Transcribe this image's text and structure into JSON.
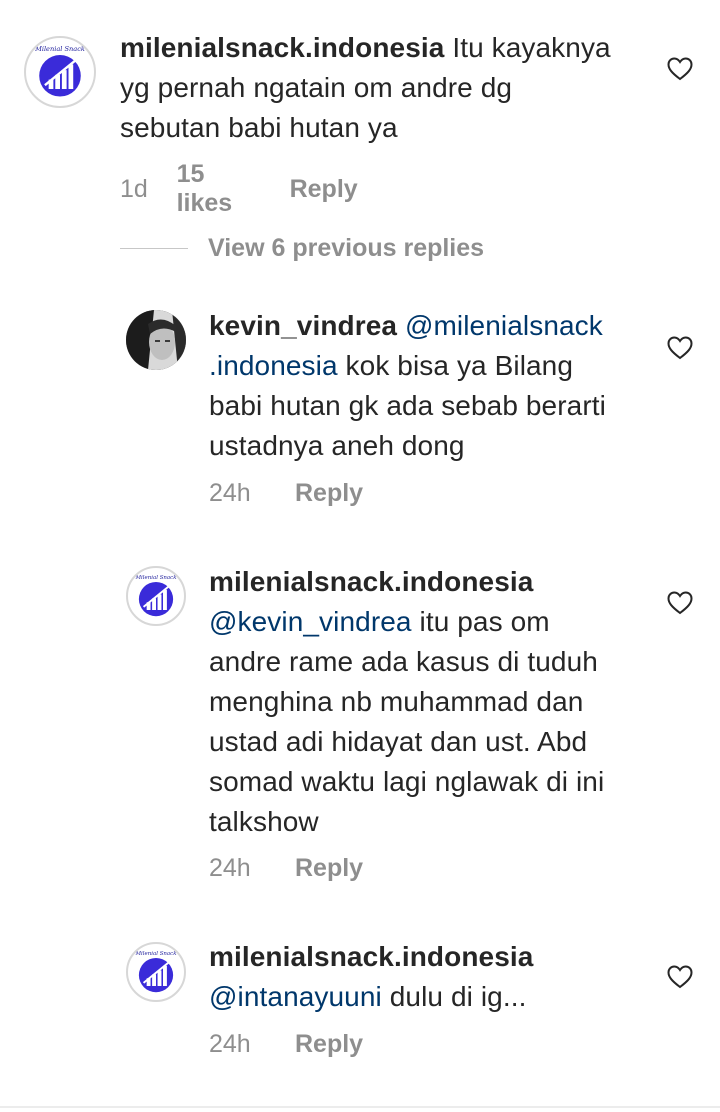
{
  "colors": {
    "text": "#262626",
    "muted": "#8e8e8e",
    "mention": "#00376b",
    "brand_blue": "#3a2bd9"
  },
  "view_replies_label": "View 6 previous replies",
  "avatar_text": "Milenial Snack",
  "comments": [
    {
      "username": "milenialsnack.indonesia",
      "lines": [
        "Itu kayaknya",
        "yg pernah ngatain om andre dg",
        "sebutan babi hutan ya"
      ],
      "time": "1d",
      "likes": "15 likes",
      "reply": "Reply",
      "avatar": "milenialsnack-logo"
    },
    {
      "username": "kevin_vindrea",
      "mention_a": "@milenialsnack",
      "mention_b": ".indonesia",
      "lines": [
        "kok bisa ya Bilang",
        "babi hutan gk ada sebab berarti",
        "ustadnya aneh dong"
      ],
      "time": "24h",
      "reply": "Reply",
      "avatar": "user-photo"
    },
    {
      "username": "milenialsnack.indonesia",
      "mention": "@kevin_vindrea",
      "lines": [
        "itu pas om",
        "andre rame ada kasus di tuduh",
        "menghina nb muhammad dan",
        "ustad adi hidayat dan ust. Abd",
        "somad waktu lagi nglawak di ini",
        "talkshow"
      ],
      "time": "24h",
      "reply": "Reply",
      "avatar": "milenialsnack-logo"
    },
    {
      "username": "milenialsnack.indonesia",
      "mention": "@intanayuuni",
      "lines": [
        "dulu di ig..."
      ],
      "time": "24h",
      "reply": "Reply",
      "avatar": "milenialsnack-logo"
    }
  ]
}
